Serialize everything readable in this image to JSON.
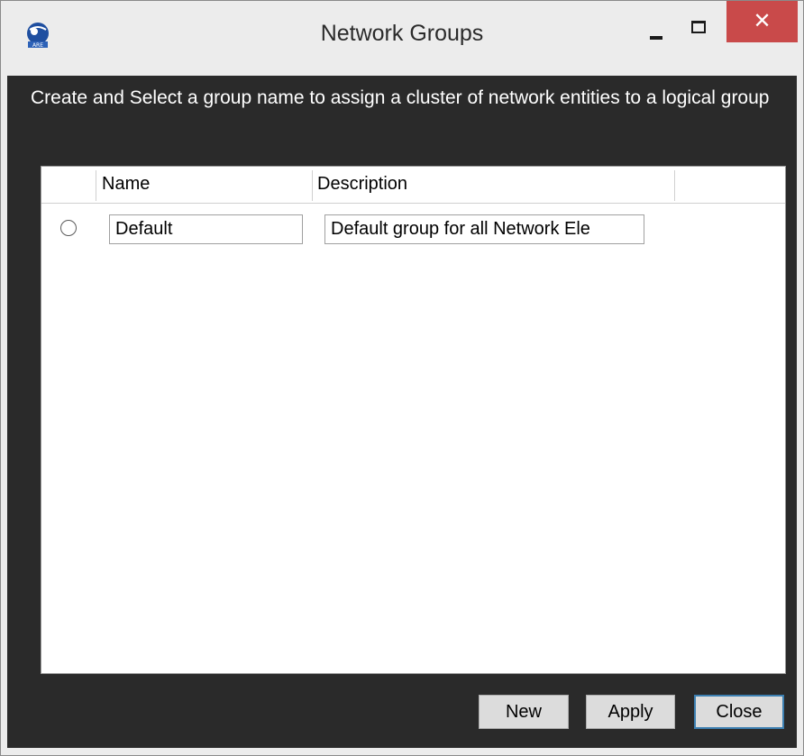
{
  "window": {
    "title": "Network Groups",
    "app_icon": "globe-app-icon",
    "controls": {
      "minimize_icon": "minimize-icon",
      "maximize_icon": "maximize-icon",
      "close_glyph": "✕",
      "close_color": "#c94a4a"
    }
  },
  "instruction": "Create and Select a group name to assign a cluster of network entities to a logical group",
  "grid": {
    "columns": [
      "Name",
      "Description"
    ],
    "rows": [
      {
        "selected": false,
        "name": "Default",
        "description": "Default group for all Network Ele"
      }
    ]
  },
  "buttons": {
    "new_label": "New",
    "apply_label": "Apply",
    "close_label": "Close"
  },
  "colors": {
    "client_background": "#2a2a2a",
    "focus_border": "#3c7fb1"
  }
}
